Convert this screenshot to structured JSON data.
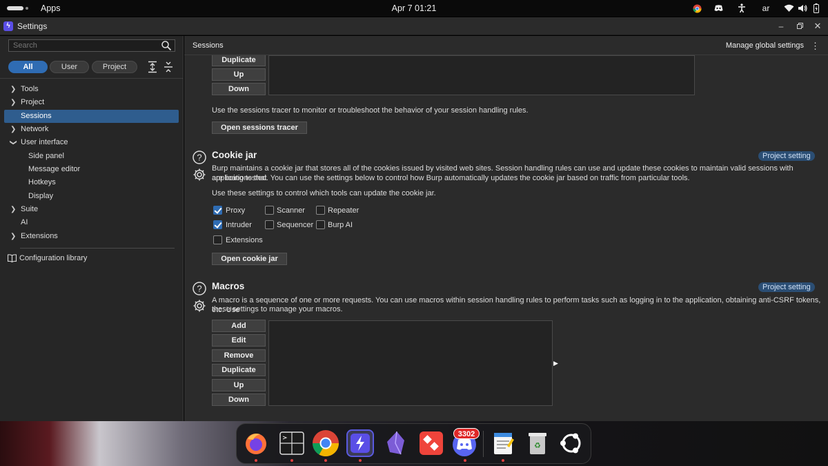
{
  "topbar": {
    "apps_label": "Apps",
    "clock": "Apr 7  01:21",
    "keyboard_layout": "ar",
    "icons": [
      "chrome-icon",
      "discord-icon",
      "accessibility-icon",
      "wifi-icon",
      "volume-icon",
      "battery-icon"
    ]
  },
  "window": {
    "title": "Settings",
    "controls": [
      "minimize-icon",
      "restore-icon",
      "close-icon"
    ]
  },
  "sidebar": {
    "search_placeholder": "Search",
    "filters": [
      {
        "label": "All",
        "active": true
      },
      {
        "label": "User",
        "active": false
      },
      {
        "label": "Project",
        "active": false
      }
    ],
    "tree": [
      {
        "label": "Tools",
        "level": 0,
        "chevron": "right"
      },
      {
        "label": "Project",
        "level": 0,
        "chevron": "right"
      },
      {
        "label": "Sessions",
        "level": 0,
        "chevron": "none",
        "selected": true
      },
      {
        "label": "Network",
        "level": 0,
        "chevron": "right"
      },
      {
        "label": "User interface",
        "level": 0,
        "chevron": "down"
      },
      {
        "label": "Side panel",
        "level": 1
      },
      {
        "label": "Message editor",
        "level": 1
      },
      {
        "label": "Hotkeys",
        "level": 1
      },
      {
        "label": "Display",
        "level": 1
      },
      {
        "label": "Suite",
        "level": 0,
        "chevron": "right"
      },
      {
        "label": "AI",
        "level": 0,
        "chevron": "none"
      },
      {
        "label": "Extensions",
        "level": 0,
        "chevron": "right"
      }
    ],
    "config_library": "Configuration library"
  },
  "main": {
    "breadcrumb": "Sessions",
    "manage_global": "Manage global settings",
    "top_buttons": [
      "Duplicate",
      "Up",
      "Down"
    ],
    "tracer_text": "Use the sessions tracer to monitor or troubleshoot the behavior of your session handling rules.",
    "tracer_button": "Open sessions tracer",
    "cookie_jar": {
      "title": "Cookie jar",
      "badge": "Project setting",
      "desc1": "Burp maintains a cookie jar that stores all of the cookies issued by visited web sites. Session handling rules can use and update these cookies to maintain valid sessions with applications that",
      "desc2": "are being tested. You can use the settings below to control how Burp automatically updates the cookie jar based on traffic from particular tools.",
      "desc3": "Use these settings to control which tools can update the cookie jar.",
      "checkboxes": [
        {
          "label": "Proxy",
          "checked": true
        },
        {
          "label": "Scanner",
          "checked": false
        },
        {
          "label": "Repeater",
          "checked": false
        },
        {
          "label": "Intruder",
          "checked": true
        },
        {
          "label": "Sequencer",
          "checked": false
        },
        {
          "label": "Burp AI",
          "checked": false
        },
        {
          "label": "Extensions",
          "checked": false
        }
      ],
      "button": "Open cookie jar"
    },
    "macros": {
      "title": "Macros",
      "badge": "Project setting",
      "desc1": "A macro is a sequence of one or more requests. You can use macros within session handling rules to perform tasks such as logging in to the application, obtaining anti-CSRF tokens, etc. Use",
      "desc2": "these settings to manage your macros.",
      "buttons": [
        "Add",
        "Edit",
        "Remove",
        "Duplicate",
        "Up",
        "Down"
      ]
    }
  },
  "dock": {
    "apps": [
      "firefox-icon",
      "system-monitor-icon",
      "chrome-icon",
      "burp-suite-icon",
      "obsidian-icon",
      "anydesk-icon",
      "discord-icon",
      "text-editor-icon",
      "trash-icon",
      "ubuntu-icon"
    ],
    "discord_badge": "3302"
  }
}
